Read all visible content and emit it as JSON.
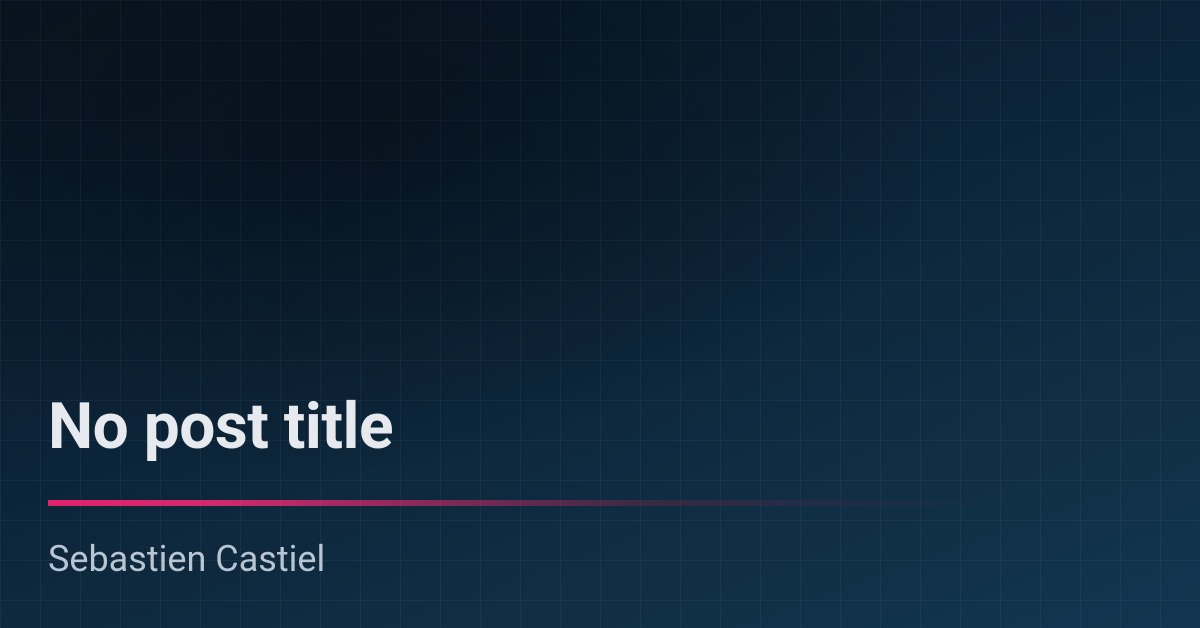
{
  "post": {
    "title": "No post title",
    "author": "Sebastien Castiel"
  },
  "colors": {
    "accent": "#e0236c",
    "bg_top": "#081521",
    "bg_bottom": "#123650",
    "text_primary": "#e6e9ee",
    "text_secondary": "#b8c5d3"
  }
}
